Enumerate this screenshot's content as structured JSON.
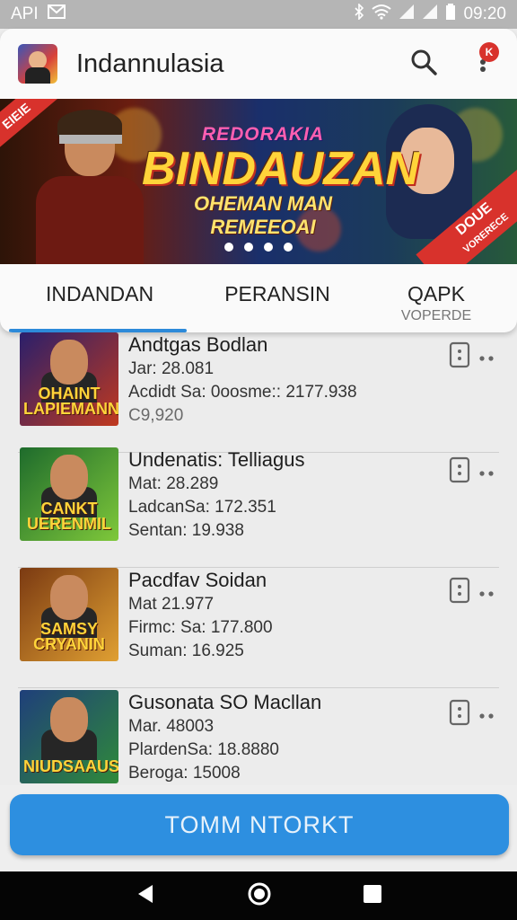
{
  "status_bar": {
    "left_text": "API",
    "time": "09:20"
  },
  "app_bar": {
    "title": "Indannulasia",
    "notification_count": "K",
    "icons": [
      "app-logo",
      "search-icon",
      "more-vertical-icon"
    ]
  },
  "banner": {
    "line1": "REDORAKIA",
    "line2": "BINDAUZAN",
    "line3": "OHEMAN MAN REMEEOAI",
    "corner_left": "EIEIE",
    "corner_right_line1": "DOUE",
    "corner_right_line2": "VORERECE",
    "carousel_pages": 4,
    "carousel_active": 1
  },
  "tabs": [
    {
      "label": "INDANDAN",
      "sub": "",
      "selected": true
    },
    {
      "label": "PERANSIN",
      "sub": "",
      "selected": false
    },
    {
      "label": "QAPK",
      "sub": "VOPERDE",
      "selected": false
    }
  ],
  "games": [
    {
      "title": "Andtgas Bodlan",
      "line1": "Jar: 28.081",
      "line2": "Acdidt Sa: 0oosme:: 2177.938",
      "line3": "C9,920",
      "thumb_label": "OHAINT LAPIEMANNS",
      "thumb_colors": [
        "#2a1f6b",
        "#c0391f"
      ]
    },
    {
      "title": "Undenatis: Telliagus",
      "line1": "Mat: 28.289",
      "line2": "LadcanSa: 172.351",
      "line3": "Sentan: 19.938",
      "thumb_label": "CANKT UERENMIL",
      "thumb_colors": [
        "#1e6b2c",
        "#7fc83a"
      ]
    },
    {
      "title": "Pacdfav Soidan",
      "line1": "Mat 21.977",
      "line2": "Firmc: Sa: 177.800",
      "line3": "Suman: 16.925",
      "thumb_label": "SAMSY CRYANIN",
      "thumb_colors": [
        "#7b3a12",
        "#e0a032"
      ]
    },
    {
      "title": "Gusonata SO Macllan",
      "line1": "Mar. 48003",
      "line2": "PlardenSa: 18.8880",
      "line3": "Beroga: 15008",
      "thumb_label": "NIUDSAAUS",
      "thumb_colors": [
        "#1f3f7a",
        "#2f8a3a"
      ]
    }
  ],
  "bottom_button": {
    "label": "TOMM NTORKT"
  },
  "colors": {
    "accent": "#2d8fe0",
    "badge": "#d8322c",
    "status_bar": "#b5b5b5"
  }
}
